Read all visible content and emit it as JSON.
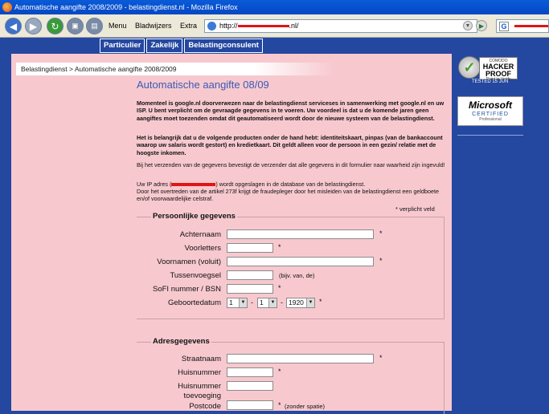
{
  "window": {
    "title": "Automatische aangifte 2008/2009 - belastingdienst.nl - Mozilla Firefox"
  },
  "toolbar": {
    "menu": "Menu",
    "bookmarks": "Bladwijzers",
    "extra": "Extra",
    "url_prefix": "http://",
    "url_suffix": ".nl/",
    "search_logo": "G"
  },
  "nav": {
    "tabs": [
      "Particulier",
      "Zakelijk",
      "Belastingconsulent"
    ]
  },
  "breadcrumb": "Belastingdienst > Automatische aangifte 2008/2009",
  "page_title": "Automatische aangifte 08/09",
  "intro": {
    "p1": "Momenteel is google.nl doorverwezen naar de belastingdienst serviceses in samenwerking met google.nl en uw ISP. U bent verplicht om de gevraagde gegevens in te voeren. Uw voordeel is dat u de komende jaren geen aangiftes moet toezenden omdat dit geautomatiseerd wordt door de nieuwe systeem van de belastingdienst.",
    "p2": "Het is belangrijk dat u de volgende producten onder de hand hebt: identiteitskaart, pinpas (van de bankaccount waarop uw salaris wordt gestort) en kredietkaart. Dit geldt alleen voor de persoon in een gezin/ relatie met de hoogste inkomen.",
    "p3": "Bij het verzenden van de gegevens bevestigt de verzender dat alle gegevens in dit formulier naar waarheid zijn ingevuld!",
    "p4_pre": "Uw IP adres (",
    "p4_post": ") wordt opgeslagen in de database van de belastingdienst.",
    "p5": "Door het overtreden van de artikel 273f krijgt de fraudepleger door het misleiden van de belastingdienst een geldboete en/of voorwaardelijke celstraf."
  },
  "required_note": "* verplicht veld",
  "personal": {
    "legend": "Persoonlijke gegevens",
    "labels": {
      "surname": "Achternaam",
      "initials": "Voorletters",
      "firstnames": "Voornamen (voluit)",
      "prefix": "Tussenvoegsel",
      "sofi": "SoFI nummer / BSN",
      "birthdate": "Geboortedatum"
    },
    "prefix_hint": "(bijv. van, de)",
    "star": "*",
    "dash": "-",
    "birth_day": "1",
    "birth_month": "1",
    "birth_year": "1920"
  },
  "address": {
    "legend": "Adresgegevens",
    "labels": {
      "street": "Straatnaam",
      "number": "Huisnummer",
      "addition_line1": "Huisnummer",
      "addition_line2": "toevoeging",
      "postcode": "Postcode"
    },
    "postcode_hint": "(zonder spatie)",
    "star": "*"
  },
  "badges": {
    "hacker_small": "COMODO",
    "hacker_big": "HACKER PROOF",
    "hacker_sub": "Point to Verify",
    "tested": "TESTED 15 JUN",
    "ms_brand": "Microsoft",
    "ms_cert": "CERTIFIED",
    "ms_sub": "Professional"
  },
  "colors": {
    "page_blue": "#2447a0",
    "content_pink": "#f7c9cf",
    "title_blue": "#3b5bb3",
    "redaction": "#e01515"
  }
}
